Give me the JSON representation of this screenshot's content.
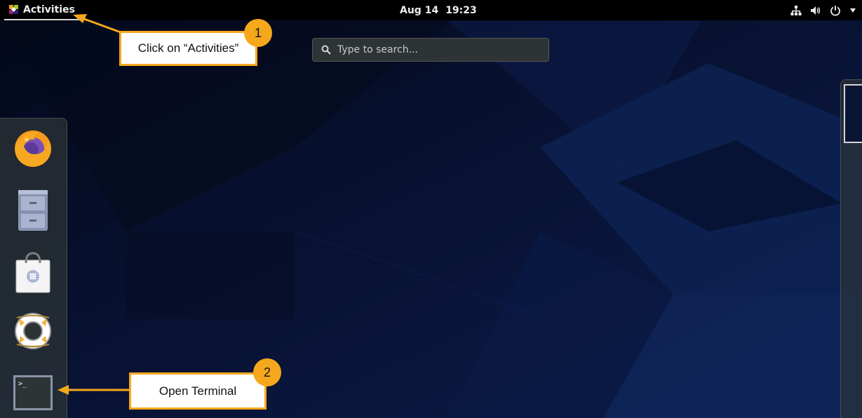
{
  "topbar": {
    "activities_label": "Activities",
    "date": "Aug 14",
    "time": "19:23"
  },
  "search": {
    "placeholder": "Type to search..."
  },
  "dash": {
    "items": [
      "firefox-icon",
      "files-icon",
      "software-icon",
      "help-icon",
      "terminal-icon"
    ]
  },
  "annotations": {
    "step1": {
      "number": "1",
      "text": "Click on “Activities”"
    },
    "step2": {
      "number": "2",
      "text": "Open Terminal"
    }
  },
  "colors": {
    "accent": "#f5a81c",
    "topbar": "#000000",
    "background": "#060b1c"
  }
}
